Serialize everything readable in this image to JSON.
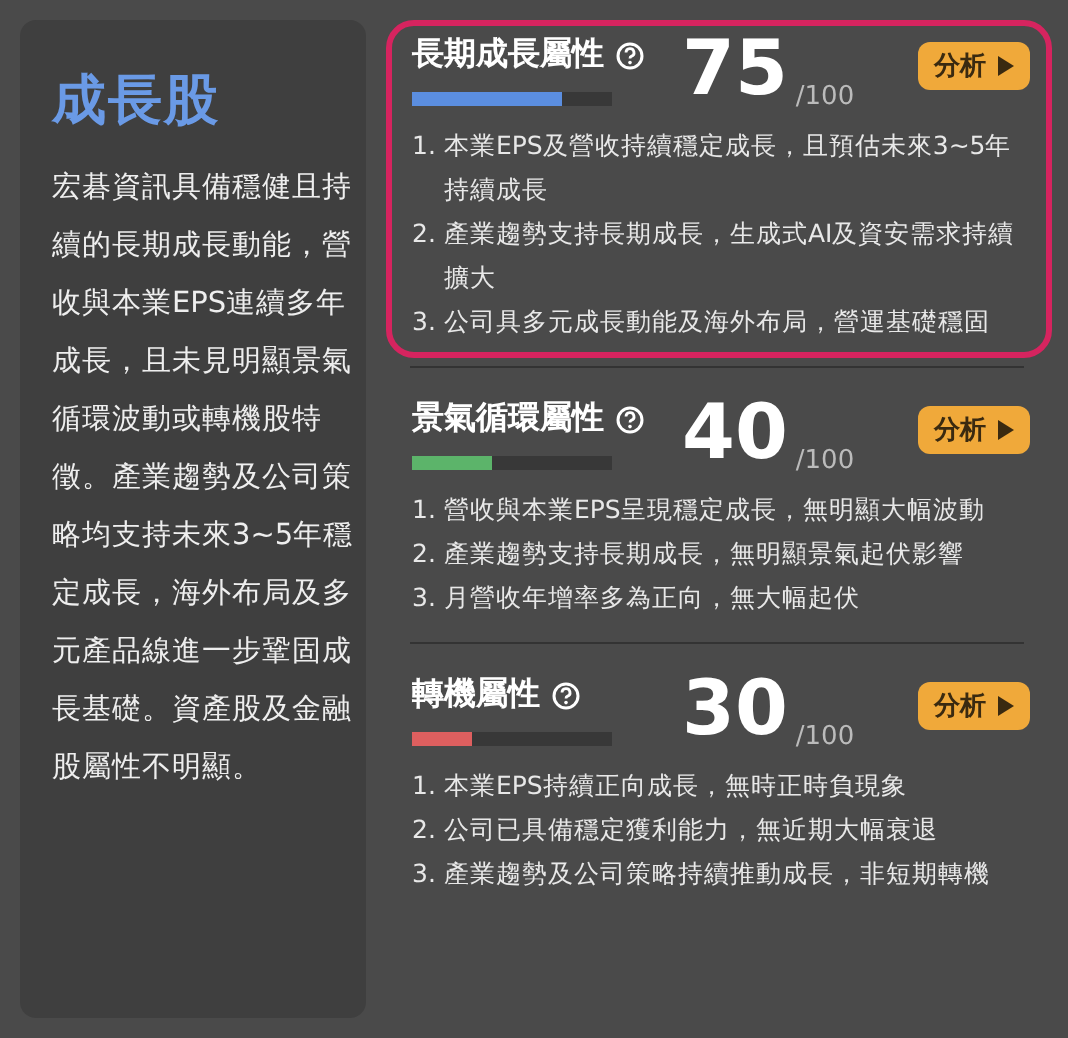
{
  "summary": {
    "title": "成長股",
    "text": "宏碁資訊具備穩健且持續的長期成長動能，營收與本業EPS連續多年成長，且未見明顯景氣循環波動或轉機股特徵。產業趨勢及公司策略均支持未來3~5年穩定成長，海外布局及多元產品線進一步鞏固成長基礎。資產股及金融股屬性不明顯。"
  },
  "attributes": [
    {
      "title": "長期成長屬性",
      "highlighted": true,
      "level": 0.75,
      "color": "#5b8ee0",
      "score": "75",
      "max": "/100",
      "button": "分析",
      "points": [
        {
          "number": "1.",
          "text": "本業EPS及營收持續穩定成長，且預估未來3~5年持續成長"
        },
        {
          "number": "2.",
          "text": "產業趨勢支持長期成長，生成式AI及資安需求持續擴大"
        },
        {
          "number": "3.",
          "text": "公司具多元成長動能及海外布局，營運基礎穩固"
        }
      ]
    },
    {
      "title": "景氣循環屬性",
      "highlighted": false,
      "level": 0.4,
      "color": "#5cb46a",
      "score": "40",
      "max": "/100",
      "button": "分析",
      "points": [
        {
          "number": "1.",
          "text": "營收與本業EPS呈現穩定成長，無明顯大幅波動"
        },
        {
          "number": "2.",
          "text": "產業趨勢支持長期成長，無明顯景氣起伏影響"
        },
        {
          "number": "3.",
          "text": "月營收年增率多為正向，無大幅起伏"
        }
      ]
    },
    {
      "title": "轉機屬性",
      "highlighted": false,
      "level": 0.3,
      "color": "#de5f5f",
      "score": "30",
      "max": "/100",
      "button": "分析",
      "points": [
        {
          "number": "1.",
          "text": "本業EPS持續正向成長，無時正時負現象"
        },
        {
          "number": "2.",
          "text": "公司已具備穩定獲利能力，無近期大幅衰退"
        },
        {
          "number": "3.",
          "text": "產業趨勢及公司策略持續推動成長，非短期轉機"
        }
      ]
    }
  ]
}
